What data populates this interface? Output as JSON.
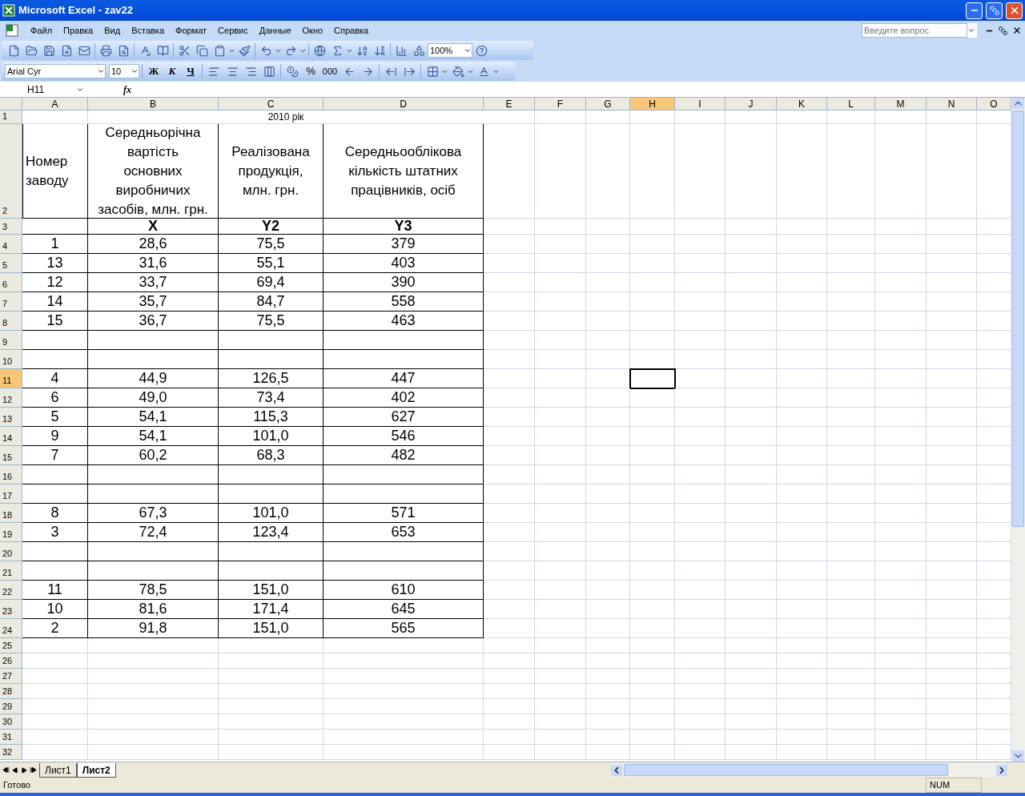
{
  "window": {
    "title": "Microsoft Excel - zav22"
  },
  "menu": [
    "Файл",
    "Правка",
    "Вид",
    "Вставка",
    "Формат",
    "Сервис",
    "Данные",
    "Окно",
    "Справка"
  ],
  "question_box": {
    "placeholder": "Введите вопрос"
  },
  "standard_toolbar": {
    "zoom": "100%"
  },
  "formatting_toolbar": {
    "font": "Arial Cyr",
    "size": "10",
    "bold": "Ж",
    "italic": "К",
    "underline": "Ч",
    "percent": "%",
    "thousands": "000"
  },
  "formula_bar": {
    "name_box": "H11",
    "fx": "fx"
  },
  "columns": [
    {
      "label": "A",
      "selected": false
    },
    {
      "label": "B",
      "selected": false
    },
    {
      "label": "C",
      "selected": false
    },
    {
      "label": "D",
      "selected": false
    },
    {
      "label": "E",
      "selected": false
    },
    {
      "label": "F",
      "selected": false
    },
    {
      "label": "G",
      "selected": false
    },
    {
      "label": "H",
      "selected": true
    },
    {
      "label": "I",
      "selected": false
    },
    {
      "label": "J",
      "selected": false
    },
    {
      "label": "K",
      "selected": false
    },
    {
      "label": "L",
      "selected": false
    },
    {
      "label": "M",
      "selected": false
    },
    {
      "label": "N",
      "selected": false
    },
    {
      "label": "O",
      "selected": false
    }
  ],
  "rows": [
    {
      "number": "1",
      "selected": false,
      "kind": "title",
      "text": "2010 рік"
    },
    {
      "number": "2",
      "selected": false,
      "kind": "header",
      "cells": [
        "Номер заводу",
        "Середньорічна вартість основних виробничих засобів, млн. грн.",
        "Реалізована продукція, млн. грн.",
        "Середньооблікова кількість штатних працівників, осіб"
      ]
    },
    {
      "number": "3",
      "selected": false,
      "kind": "label",
      "cells": [
        "",
        "X",
        "Y2",
        "Y3"
      ]
    },
    {
      "number": "4",
      "selected": false,
      "kind": "data",
      "cells": [
        "1",
        "28,6",
        "75,5",
        "379"
      ]
    },
    {
      "number": "5",
      "selected": false,
      "kind": "data",
      "cells": [
        "13",
        "31,6",
        "55,1",
        "403"
      ]
    },
    {
      "number": "6",
      "selected": false,
      "kind": "data",
      "cells": [
        "12",
        "33,7",
        "69,4",
        "390"
      ]
    },
    {
      "number": "7",
      "selected": false,
      "kind": "data",
      "cells": [
        "14",
        "35,7",
        "84,7",
        "558"
      ]
    },
    {
      "number": "8",
      "selected": false,
      "kind": "data",
      "cells": [
        "15",
        "36,7",
        "75,5",
        "463"
      ]
    },
    {
      "number": "9",
      "selected": false,
      "kind": "data"
    },
    {
      "number": "10",
      "selected": false,
      "kind": "data"
    },
    {
      "number": "11",
      "selected": true,
      "kind": "data",
      "cells": [
        "4",
        "44,9",
        "126,5",
        "447"
      ]
    },
    {
      "number": "12",
      "selected": false,
      "kind": "data",
      "cells": [
        "6",
        "49,0",
        "73,4",
        "402"
      ]
    },
    {
      "number": "13",
      "selected": false,
      "kind": "data",
      "cells": [
        "5",
        "54,1",
        "115,3",
        "627"
      ]
    },
    {
      "number": "14",
      "selected": false,
      "kind": "data",
      "cells": [
        "9",
        "54,1",
        "101,0",
        "546"
      ]
    },
    {
      "number": "15",
      "selected": false,
      "kind": "data",
      "cells": [
        "7",
        "60,2",
        "68,3",
        "482"
      ]
    },
    {
      "number": "16",
      "selected": false,
      "kind": "data"
    },
    {
      "number": "17",
      "selected": false,
      "kind": "data"
    },
    {
      "number": "18",
      "selected": false,
      "kind": "data",
      "cells": [
        "8",
        "67,3",
        "101,0",
        "571"
      ]
    },
    {
      "number": "19",
      "selected": false,
      "kind": "data",
      "cells": [
        "3",
        "72,4",
        "123,4",
        "653"
      ]
    },
    {
      "number": "20",
      "selected": false,
      "kind": "data"
    },
    {
      "number": "21",
      "selected": false,
      "kind": "data"
    },
    {
      "number": "22",
      "selected": false,
      "kind": "data",
      "cells": [
        "11",
        "78,5",
        "151,0",
        "610"
      ]
    },
    {
      "number": "23",
      "selected": false,
      "kind": "data",
      "cells": [
        "10",
        "81,6",
        "171,4",
        "645"
      ]
    },
    {
      "number": "24",
      "selected": false,
      "kind": "data",
      "cells": [
        "2",
        "91,8",
        "151,0",
        "565"
      ]
    },
    {
      "number": "25",
      "selected": false,
      "kind": "plain"
    },
    {
      "number": "26",
      "selected": false,
      "kind": "plain"
    },
    {
      "number": "27",
      "selected": false,
      "kind": "plain"
    },
    {
      "number": "28",
      "selected": false,
      "kind": "plain"
    },
    {
      "number": "29",
      "selected": false,
      "kind": "plain"
    },
    {
      "number": "30",
      "selected": false,
      "kind": "plain"
    },
    {
      "number": "31",
      "selected": false,
      "kind": "plain"
    },
    {
      "number": "32",
      "selected": false,
      "kind": "plain"
    }
  ],
  "sheet_tabs": [
    {
      "label": "Лист1",
      "selected": false
    },
    {
      "label": "Лист2",
      "selected": true
    }
  ],
  "status_bar": {
    "text": "Готово",
    "num": "NUM"
  }
}
